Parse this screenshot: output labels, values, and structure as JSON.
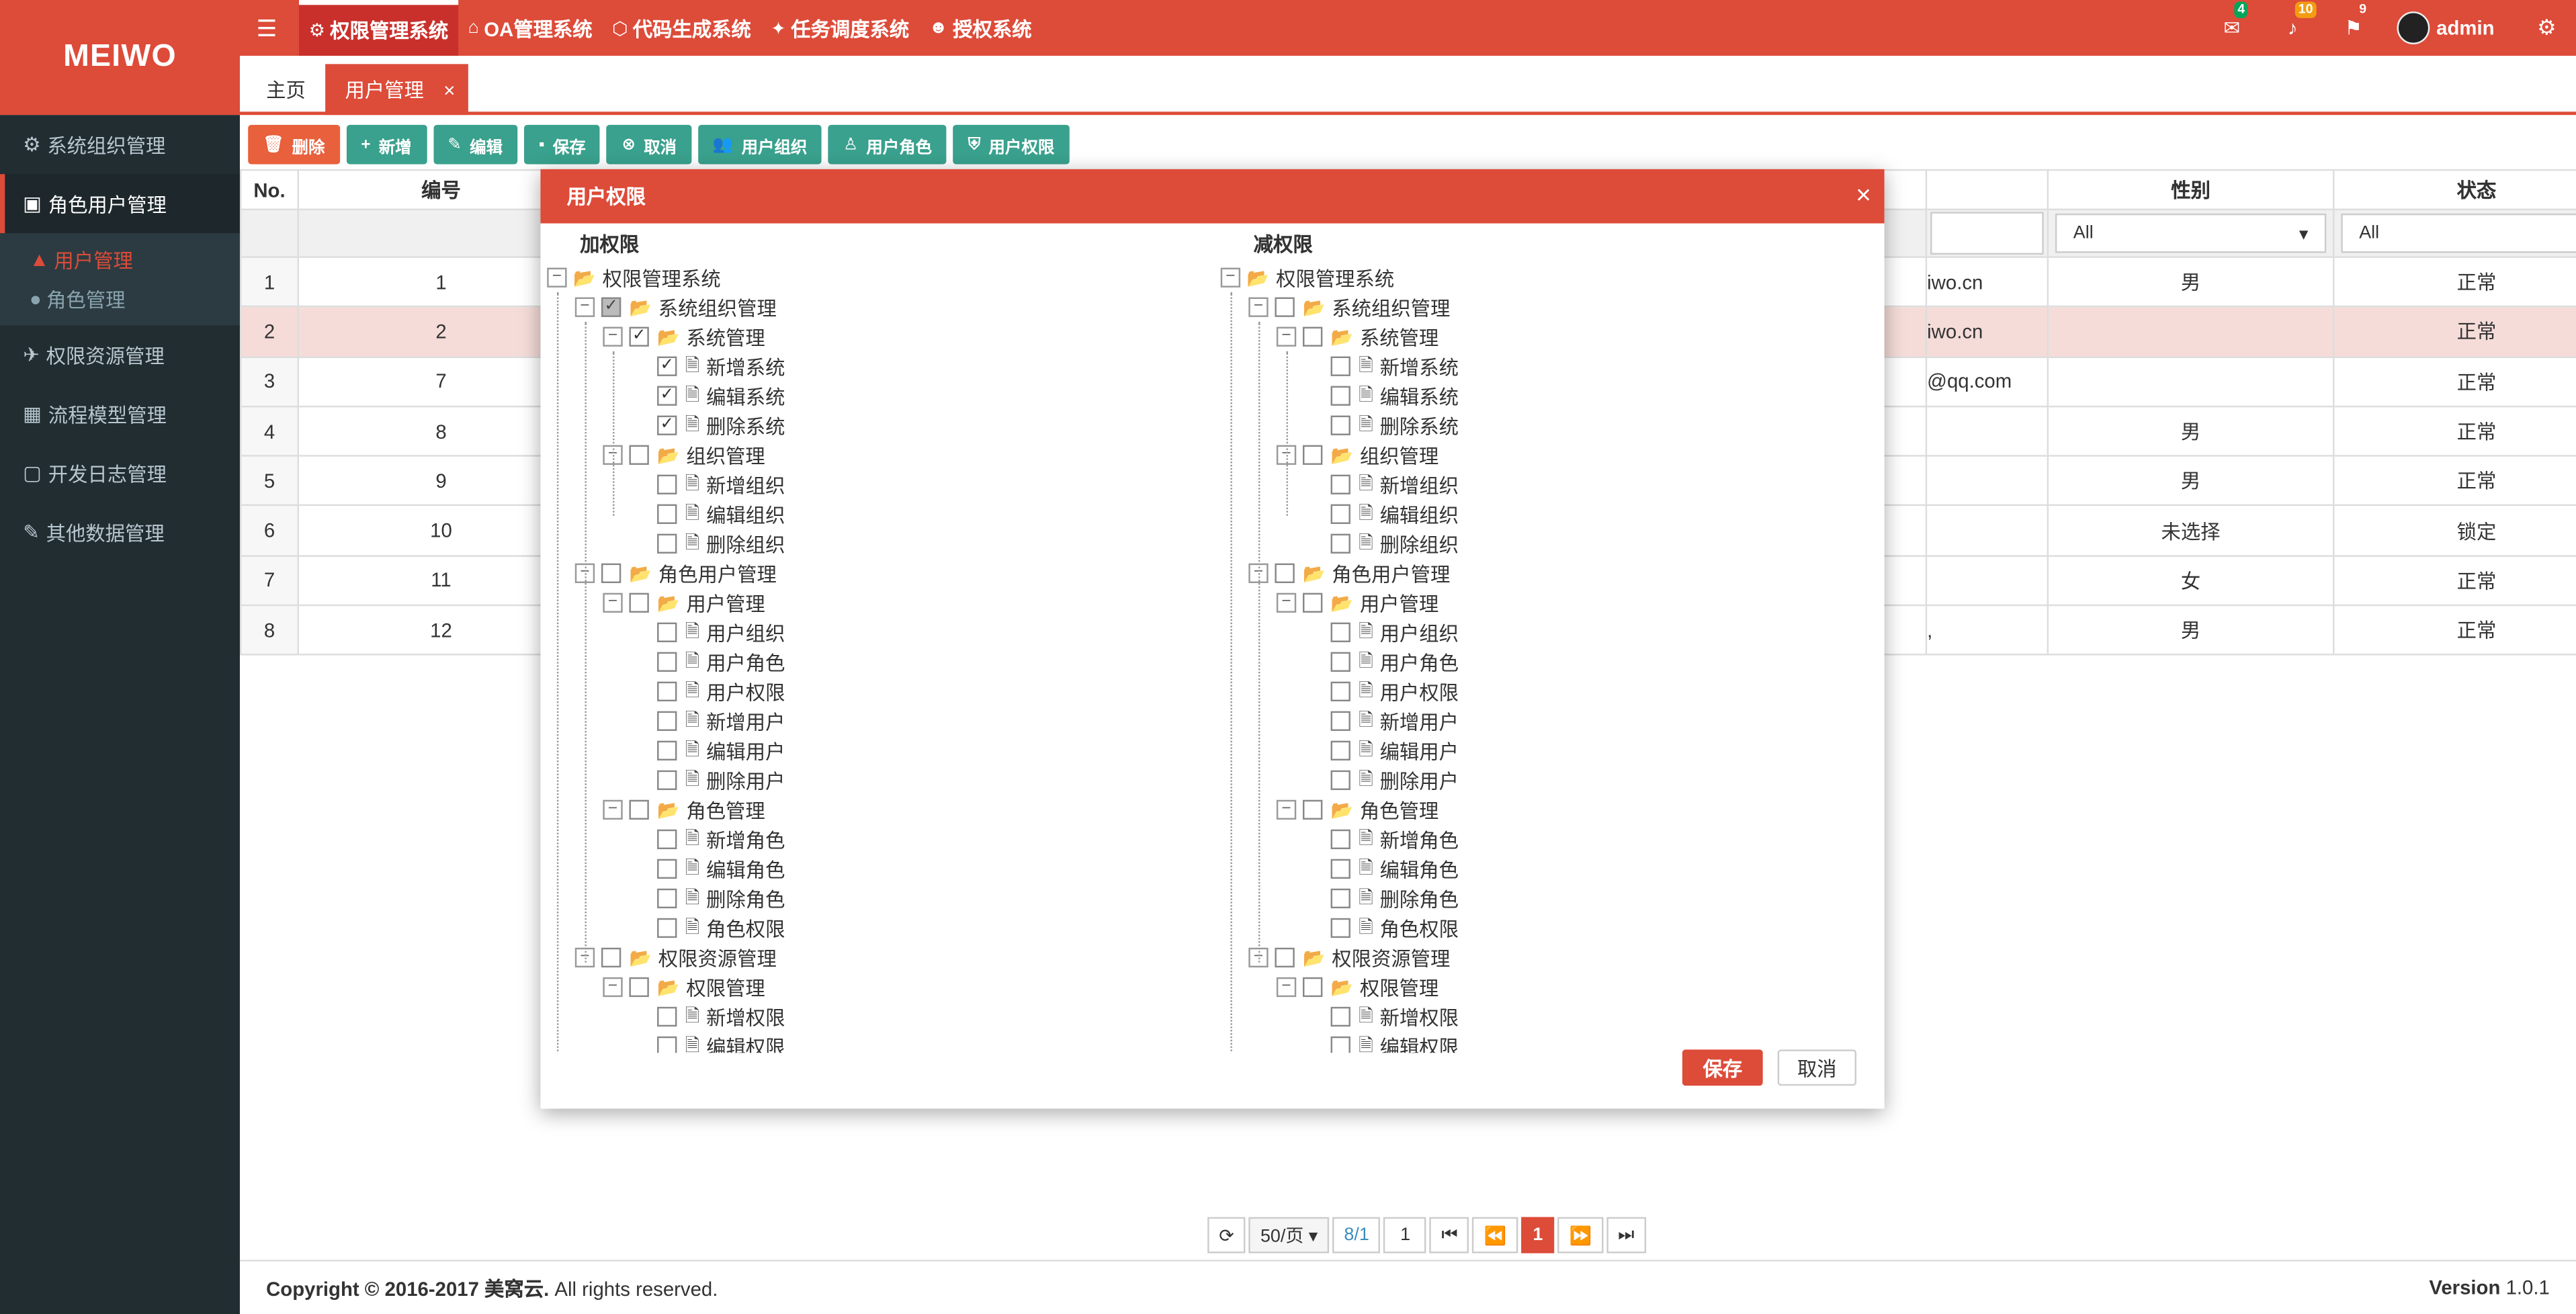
{
  "brand": "MEIWO",
  "topnav": {
    "toggle_icon": "☰",
    "systems": [
      {
        "label": "权限管理系统",
        "icon": "⚙",
        "active": true
      },
      {
        "label": "OA管理系统",
        "icon": "⌂"
      },
      {
        "label": "代码生成系统",
        "icon": "⬡"
      },
      {
        "label": "任务调度系统",
        "icon": "✦"
      },
      {
        "label": "授权系统",
        "icon": "☻"
      }
    ],
    "mail_badge": "4",
    "bell_badge": "10",
    "flag_badge": "9",
    "username": "admin"
  },
  "tabs": {
    "home": "主页",
    "user": "用户管理",
    "close": "×"
  },
  "sidebar": {
    "items": [
      {
        "label": "系统组织管理",
        "icon": "⚙"
      },
      {
        "label": "角色用户管理",
        "icon": "▣"
      },
      {
        "label": "权限资源管理",
        "icon": "✈"
      },
      {
        "label": "流程模型管理",
        "icon": "▦"
      },
      {
        "label": "开发日志管理",
        "icon": "▢"
      },
      {
        "label": "其他数据管理",
        "icon": "✎"
      }
    ],
    "subitems": [
      {
        "label": "用户管理",
        "icon": "▲"
      },
      {
        "label": "角色管理",
        "icon": "●"
      }
    ]
  },
  "toolbar": {
    "delete": "删除",
    "add": "新增",
    "edit": "编辑",
    "save": "保存",
    "cancel": "取消",
    "user_org": "用户组织",
    "user_role": "用户角色",
    "user_perm": "用户权限"
  },
  "table": {
    "headers": {
      "no": "No.",
      "code": "编号",
      "gender": "性别",
      "status": "状态"
    },
    "filter_all": "All",
    "rows": [
      {
        "no": "1",
        "code": "1",
        "email": "iwo.cn",
        "gender": "男",
        "status": "正常"
      },
      {
        "no": "2",
        "code": "2",
        "email": "iwo.cn",
        "gender": "",
        "status": "正常"
      },
      {
        "no": "3",
        "code": "7",
        "email": "@qq.com",
        "gender": "",
        "status": "正常"
      },
      {
        "no": "4",
        "code": "8",
        "email": "",
        "gender": "男",
        "status": "正常"
      },
      {
        "no": "5",
        "code": "9",
        "email": "",
        "gender": "男",
        "status": "正常"
      },
      {
        "no": "6",
        "code": "10",
        "email": "",
        "gender": "未选择",
        "status": "锁定"
      },
      {
        "no": "7",
        "code": "11",
        "email": "",
        "gender": "女",
        "status": "正常"
      },
      {
        "no": "8",
        "code": "12",
        "email": ",",
        "gender": "男",
        "status": "正常"
      }
    ]
  },
  "modal": {
    "title": "用户权限",
    "close": "×",
    "left_title": "加权限",
    "right_title": "减权限",
    "save": "保存",
    "cancel": "取消"
  },
  "tree_labels": {
    "root": "权限管理系统",
    "sys_org": "系统组织管理",
    "sys_mgmt": "系统管理",
    "add_sys": "新增系统",
    "edit_sys": "编辑系统",
    "del_sys": "删除系统",
    "org_mgmt": "组织管理",
    "add_org": "新增组织",
    "edit_org": "编辑组织",
    "del_org": "删除组织",
    "role_user": "角色用户管理",
    "user_mgmt": "用户管理",
    "user_org": "用户组织",
    "user_role": "用户角色",
    "user_perm": "用户权限",
    "add_user": "新增用户",
    "edit_user": "编辑用户",
    "del_user": "删除用户",
    "role_mgmt": "角色管理",
    "add_role": "新增角色",
    "edit_role": "编辑角色",
    "del_role": "删除角色",
    "role_perm": "角色权限",
    "perm_res": "权限资源管理",
    "perm_mgmt": "权限管理",
    "add_perm": "新增权限",
    "edit_perm": "编辑权限"
  },
  "pager": {
    "page_size": "50/页",
    "info": "8/1",
    "page_input": "1",
    "current": "1"
  },
  "footer": {
    "copyright_bold": "Copyright © 2016-2017 美窝云.",
    "copyright_rest": " All rights reserved.",
    "version_label": "Version",
    "version": "1.0.1"
  }
}
